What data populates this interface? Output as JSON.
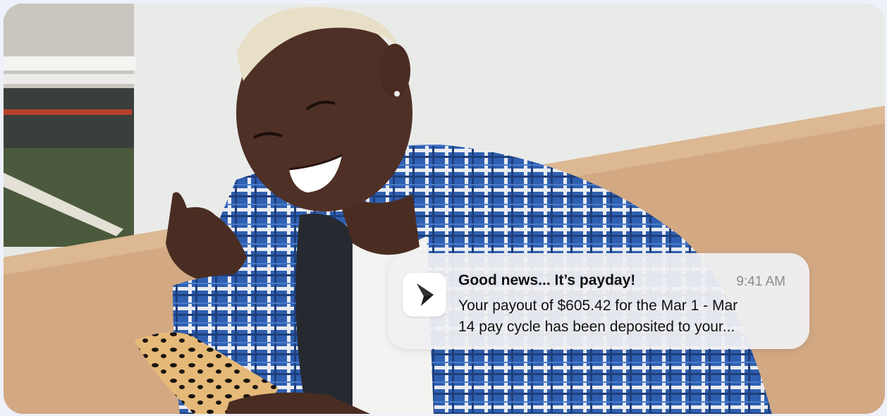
{
  "notification": {
    "app_icon": "chevron-right-icon",
    "title": "Good news... It’s payday!",
    "time": "9:41 AM",
    "body_line1": "Your payout of $605.42 for the Mar 1 - Mar",
    "body_line2": "14 pay cycle has been deposited to your..."
  },
  "colors": {
    "page_background": "#eef0fa",
    "notification_background": "#f0f0f2",
    "text_primary": "#111111",
    "text_secondary": "#8a8a8e"
  }
}
